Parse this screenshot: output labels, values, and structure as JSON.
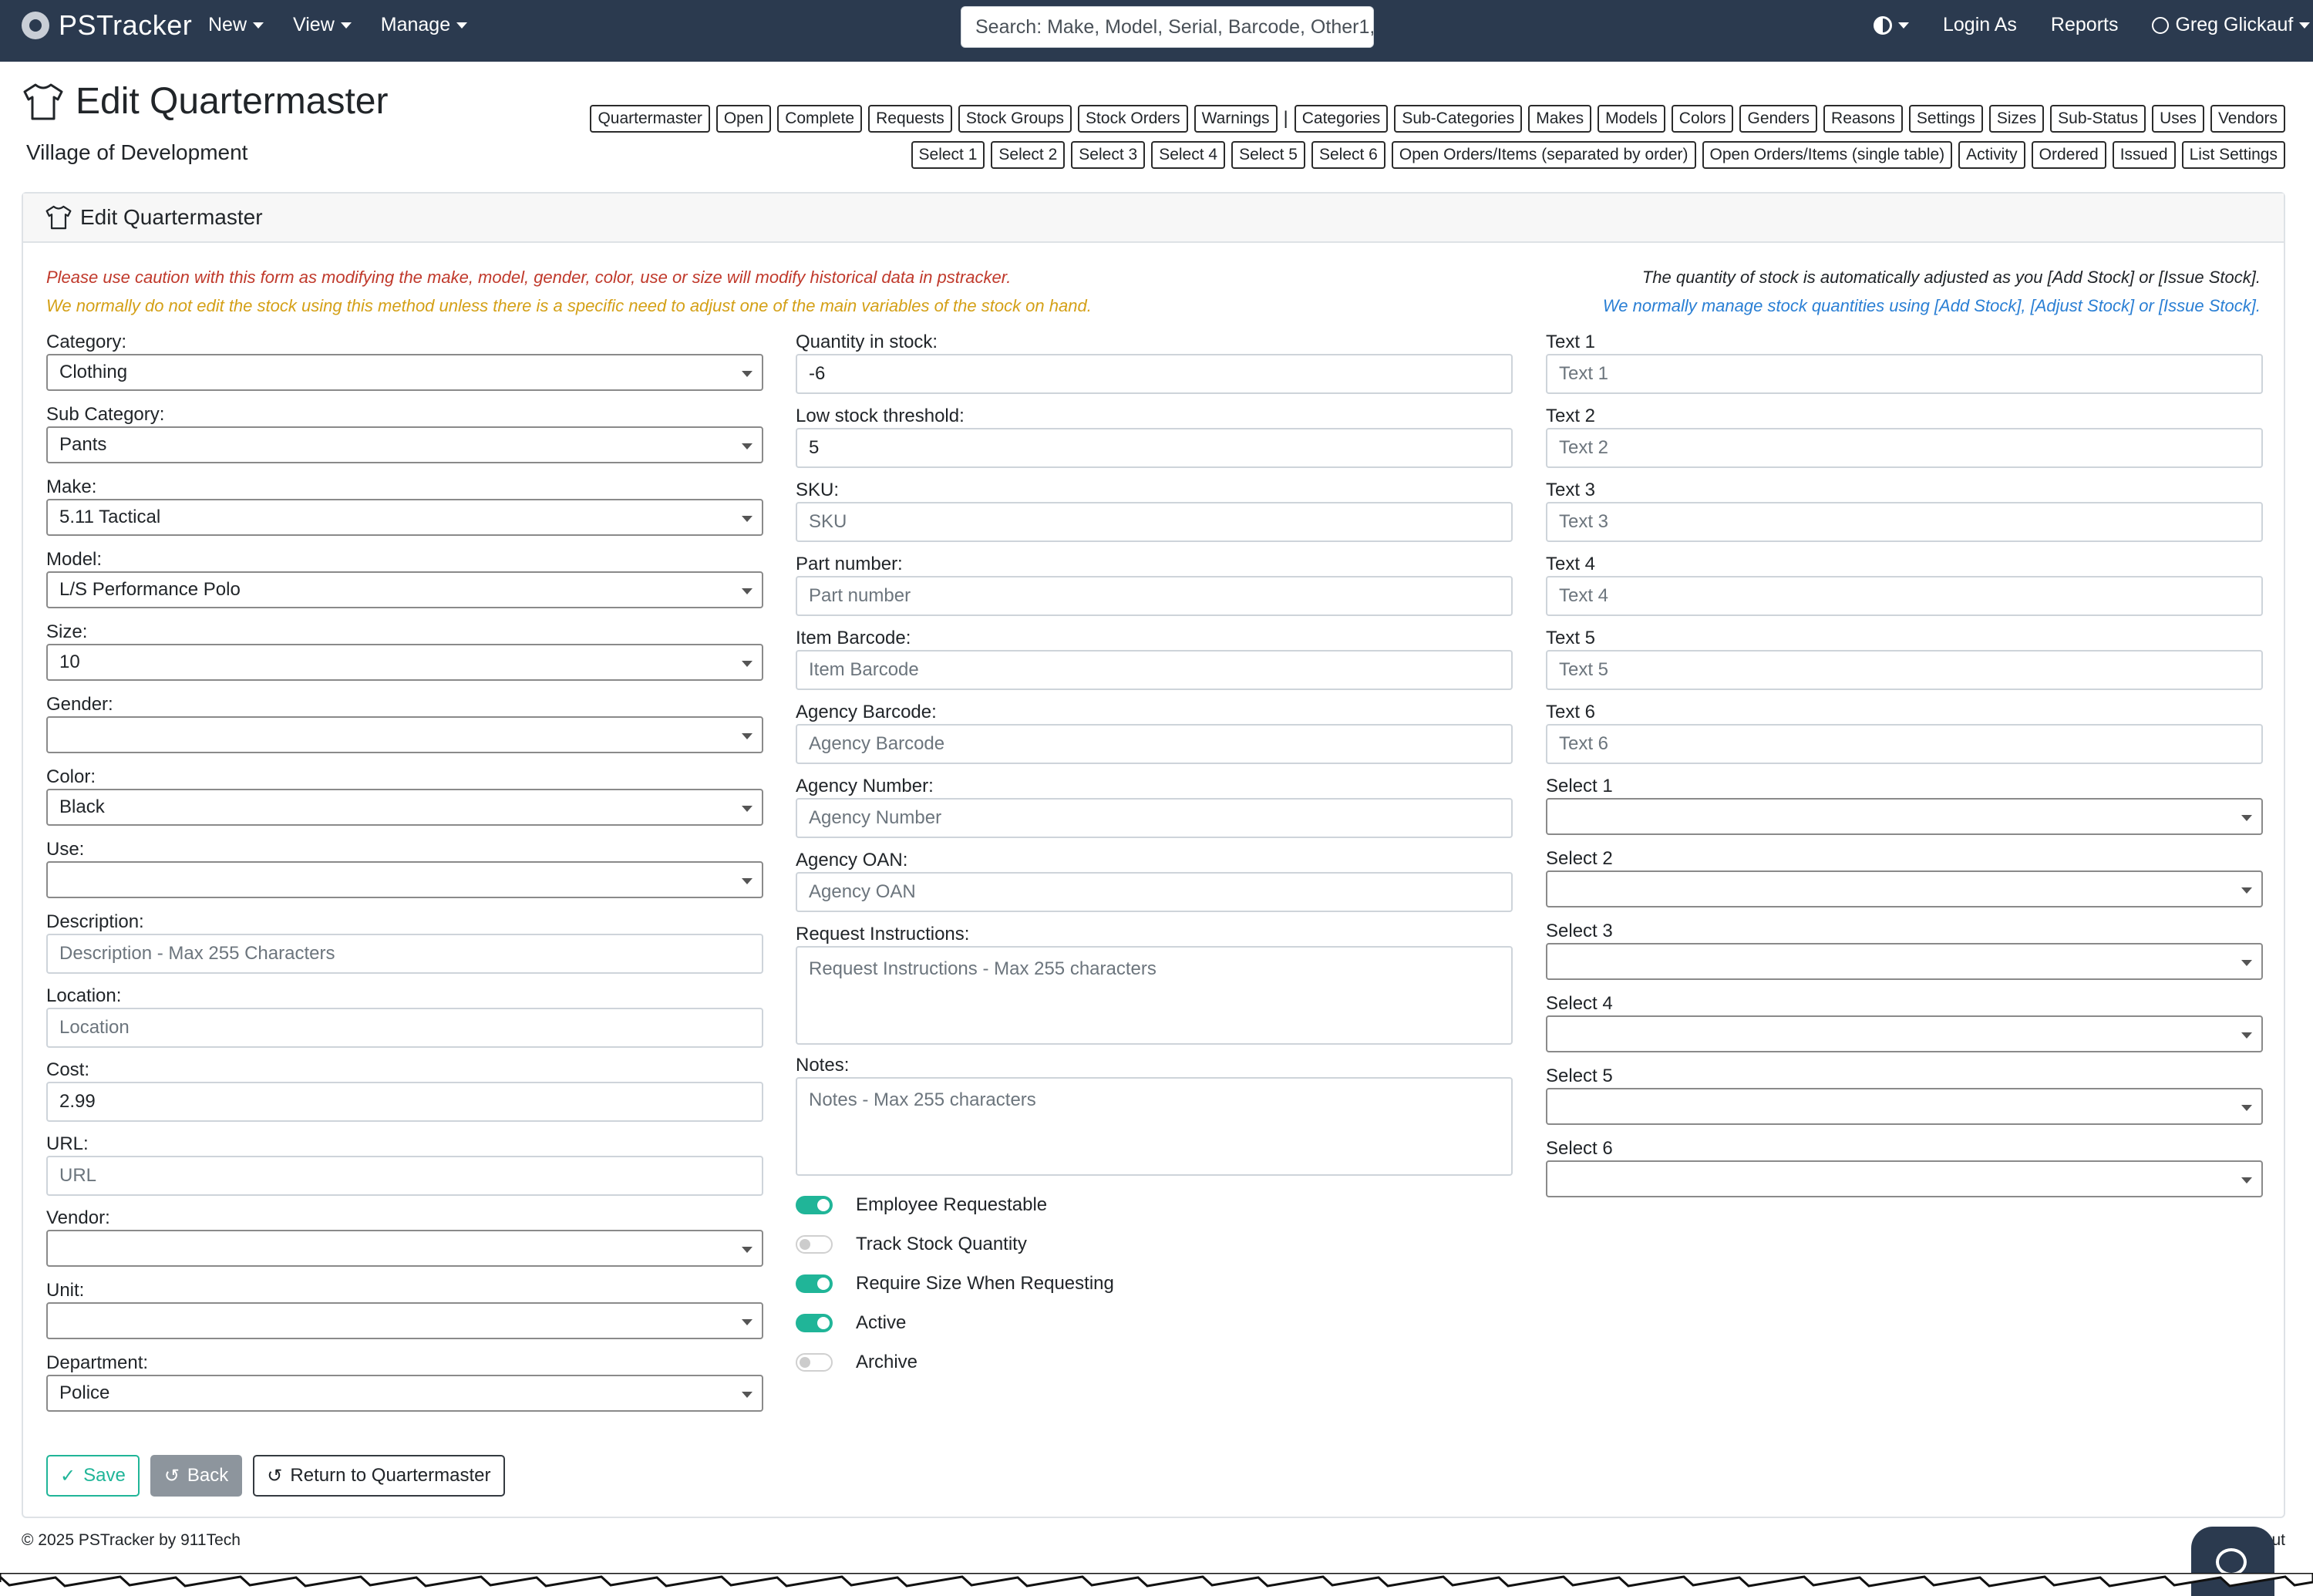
{
  "navbar": {
    "brand": "PSTracker",
    "menu": [
      "New",
      "View",
      "Manage"
    ],
    "search_placeholder": "Search: Make, Model, Serial, Barcode, Other1,",
    "login_as": "Login As",
    "reports": "Reports",
    "user": "Greg Glickauf"
  },
  "header": {
    "title": "Edit Quartermaster",
    "subtitle": "Village of Development",
    "buttons_row1": [
      "Quartermaster",
      "Open",
      "Complete",
      "Requests",
      "Stock Groups",
      "Stock Orders",
      "Warnings",
      "|",
      "Categories",
      "Sub-Categories",
      "Makes",
      "Models",
      "Colors",
      "Genders",
      "Reasons",
      "Settings",
      "Sizes",
      "Sub-Status",
      "Uses",
      "Vendors"
    ],
    "buttons_row2": [
      "Select 1",
      "Select 2",
      "Select 3",
      "Select 4",
      "Select 5",
      "Select 6",
      "Open Orders/Items (separated by order)",
      "Open Orders/Items (single table)",
      "Activity",
      "Ordered",
      "Issued",
      "List Settings"
    ]
  },
  "card": {
    "title": "Edit Quartermaster",
    "warning1": "Please use caution with this form as modifying the make, model, gender, color, use or size will modify historical data in pstracker.",
    "warning2": "We normally do not edit the stock using this method unless there is a specific need to adjust one of the main variables of the stock on hand.",
    "note1": "The quantity of stock is automatically adjusted as you [Add Stock] or [Issue Stock].",
    "note2": "We normally manage stock quantities using [Add Stock], [Adjust Stock] or [Issue Stock]."
  },
  "col1": [
    {
      "label": "Category:",
      "value": "Clothing"
    },
    {
      "label": "Sub Category:",
      "value": "Pants"
    },
    {
      "label": "Make:",
      "value": "5.11 Tactical"
    },
    {
      "label": "Model:",
      "value": "L/S Performance Polo"
    },
    {
      "label": "Size:",
      "value": "10"
    },
    {
      "label": "Gender:",
      "value": ""
    },
    {
      "label": "Color:",
      "value": "Black"
    },
    {
      "label": "Use:",
      "value": ""
    }
  ],
  "col1b": [
    {
      "label": "Description:",
      "value": "",
      "placeholder": "Description - Max 255 Characters"
    },
    {
      "label": "Location:",
      "value": "",
      "placeholder": "Location"
    },
    {
      "label": "Cost:",
      "value": "2.99",
      "placeholder": ""
    },
    {
      "label": "URL:",
      "value": "",
      "placeholder": "URL"
    }
  ],
  "col1c": [
    {
      "label": "Vendor:",
      "value": ""
    },
    {
      "label": "Unit:",
      "value": ""
    },
    {
      "label": "Department:",
      "value": "Police"
    }
  ],
  "col2": [
    {
      "label": "Quantity in stock:",
      "value": "-6",
      "placeholder": ""
    },
    {
      "label": "Low stock threshold:",
      "value": "5",
      "placeholder": ""
    },
    {
      "label": "SKU:",
      "value": "",
      "placeholder": "SKU"
    },
    {
      "label": "Part number:",
      "value": "",
      "placeholder": "Part number"
    },
    {
      "label": "Item Barcode:",
      "value": "",
      "placeholder": "Item Barcode"
    },
    {
      "label": "Agency Barcode:",
      "value": "",
      "placeholder": "Agency Barcode"
    },
    {
      "label": "Agency Number:",
      "value": "",
      "placeholder": "Agency Number"
    },
    {
      "label": "Agency OAN:",
      "value": "",
      "placeholder": "Agency OAN"
    }
  ],
  "textareas": [
    {
      "label": "Request Instructions:",
      "placeholder": "Request Instructions - Max 255 characters"
    },
    {
      "label": "Notes:",
      "placeholder": "Notes - Max 255 characters"
    }
  ],
  "toggles": [
    {
      "label": "Employee Requestable",
      "on": true
    },
    {
      "label": "Track Stock Quantity",
      "on": false
    },
    {
      "label": "Require Size When Requesting",
      "on": true
    },
    {
      "label": "Active",
      "on": true
    },
    {
      "label": "Archive",
      "on": false
    }
  ],
  "col3": [
    {
      "label": "Text 1",
      "placeholder": "Text 1"
    },
    {
      "label": "Text 2",
      "placeholder": "Text 2"
    },
    {
      "label": "Text 3",
      "placeholder": "Text 3"
    },
    {
      "label": "Text 4",
      "placeholder": "Text 4"
    },
    {
      "label": "Text 5",
      "placeholder": "Text 5"
    },
    {
      "label": "Text 6",
      "placeholder": "Text 6"
    }
  ],
  "col3b": [
    {
      "label": "Select 1",
      "value": ""
    },
    {
      "label": "Select 2",
      "value": ""
    },
    {
      "label": "Select 3",
      "value": ""
    },
    {
      "label": "Select 4",
      "value": ""
    },
    {
      "label": "Select 5",
      "value": ""
    },
    {
      "label": "Select 6",
      "value": ""
    }
  ],
  "actions": {
    "save": "Save",
    "back": "Back",
    "return": "Return to Quartermaster"
  },
  "footer": {
    "copyright": "© 2025  PSTracker by 911Tech",
    "right": "Su          ut"
  },
  "colors": {
    "navbar": "#2b3a4f",
    "accent": "#20b598",
    "warning": "#c0392b",
    "caution": "#d4a017",
    "info": "#2a7fd4"
  }
}
